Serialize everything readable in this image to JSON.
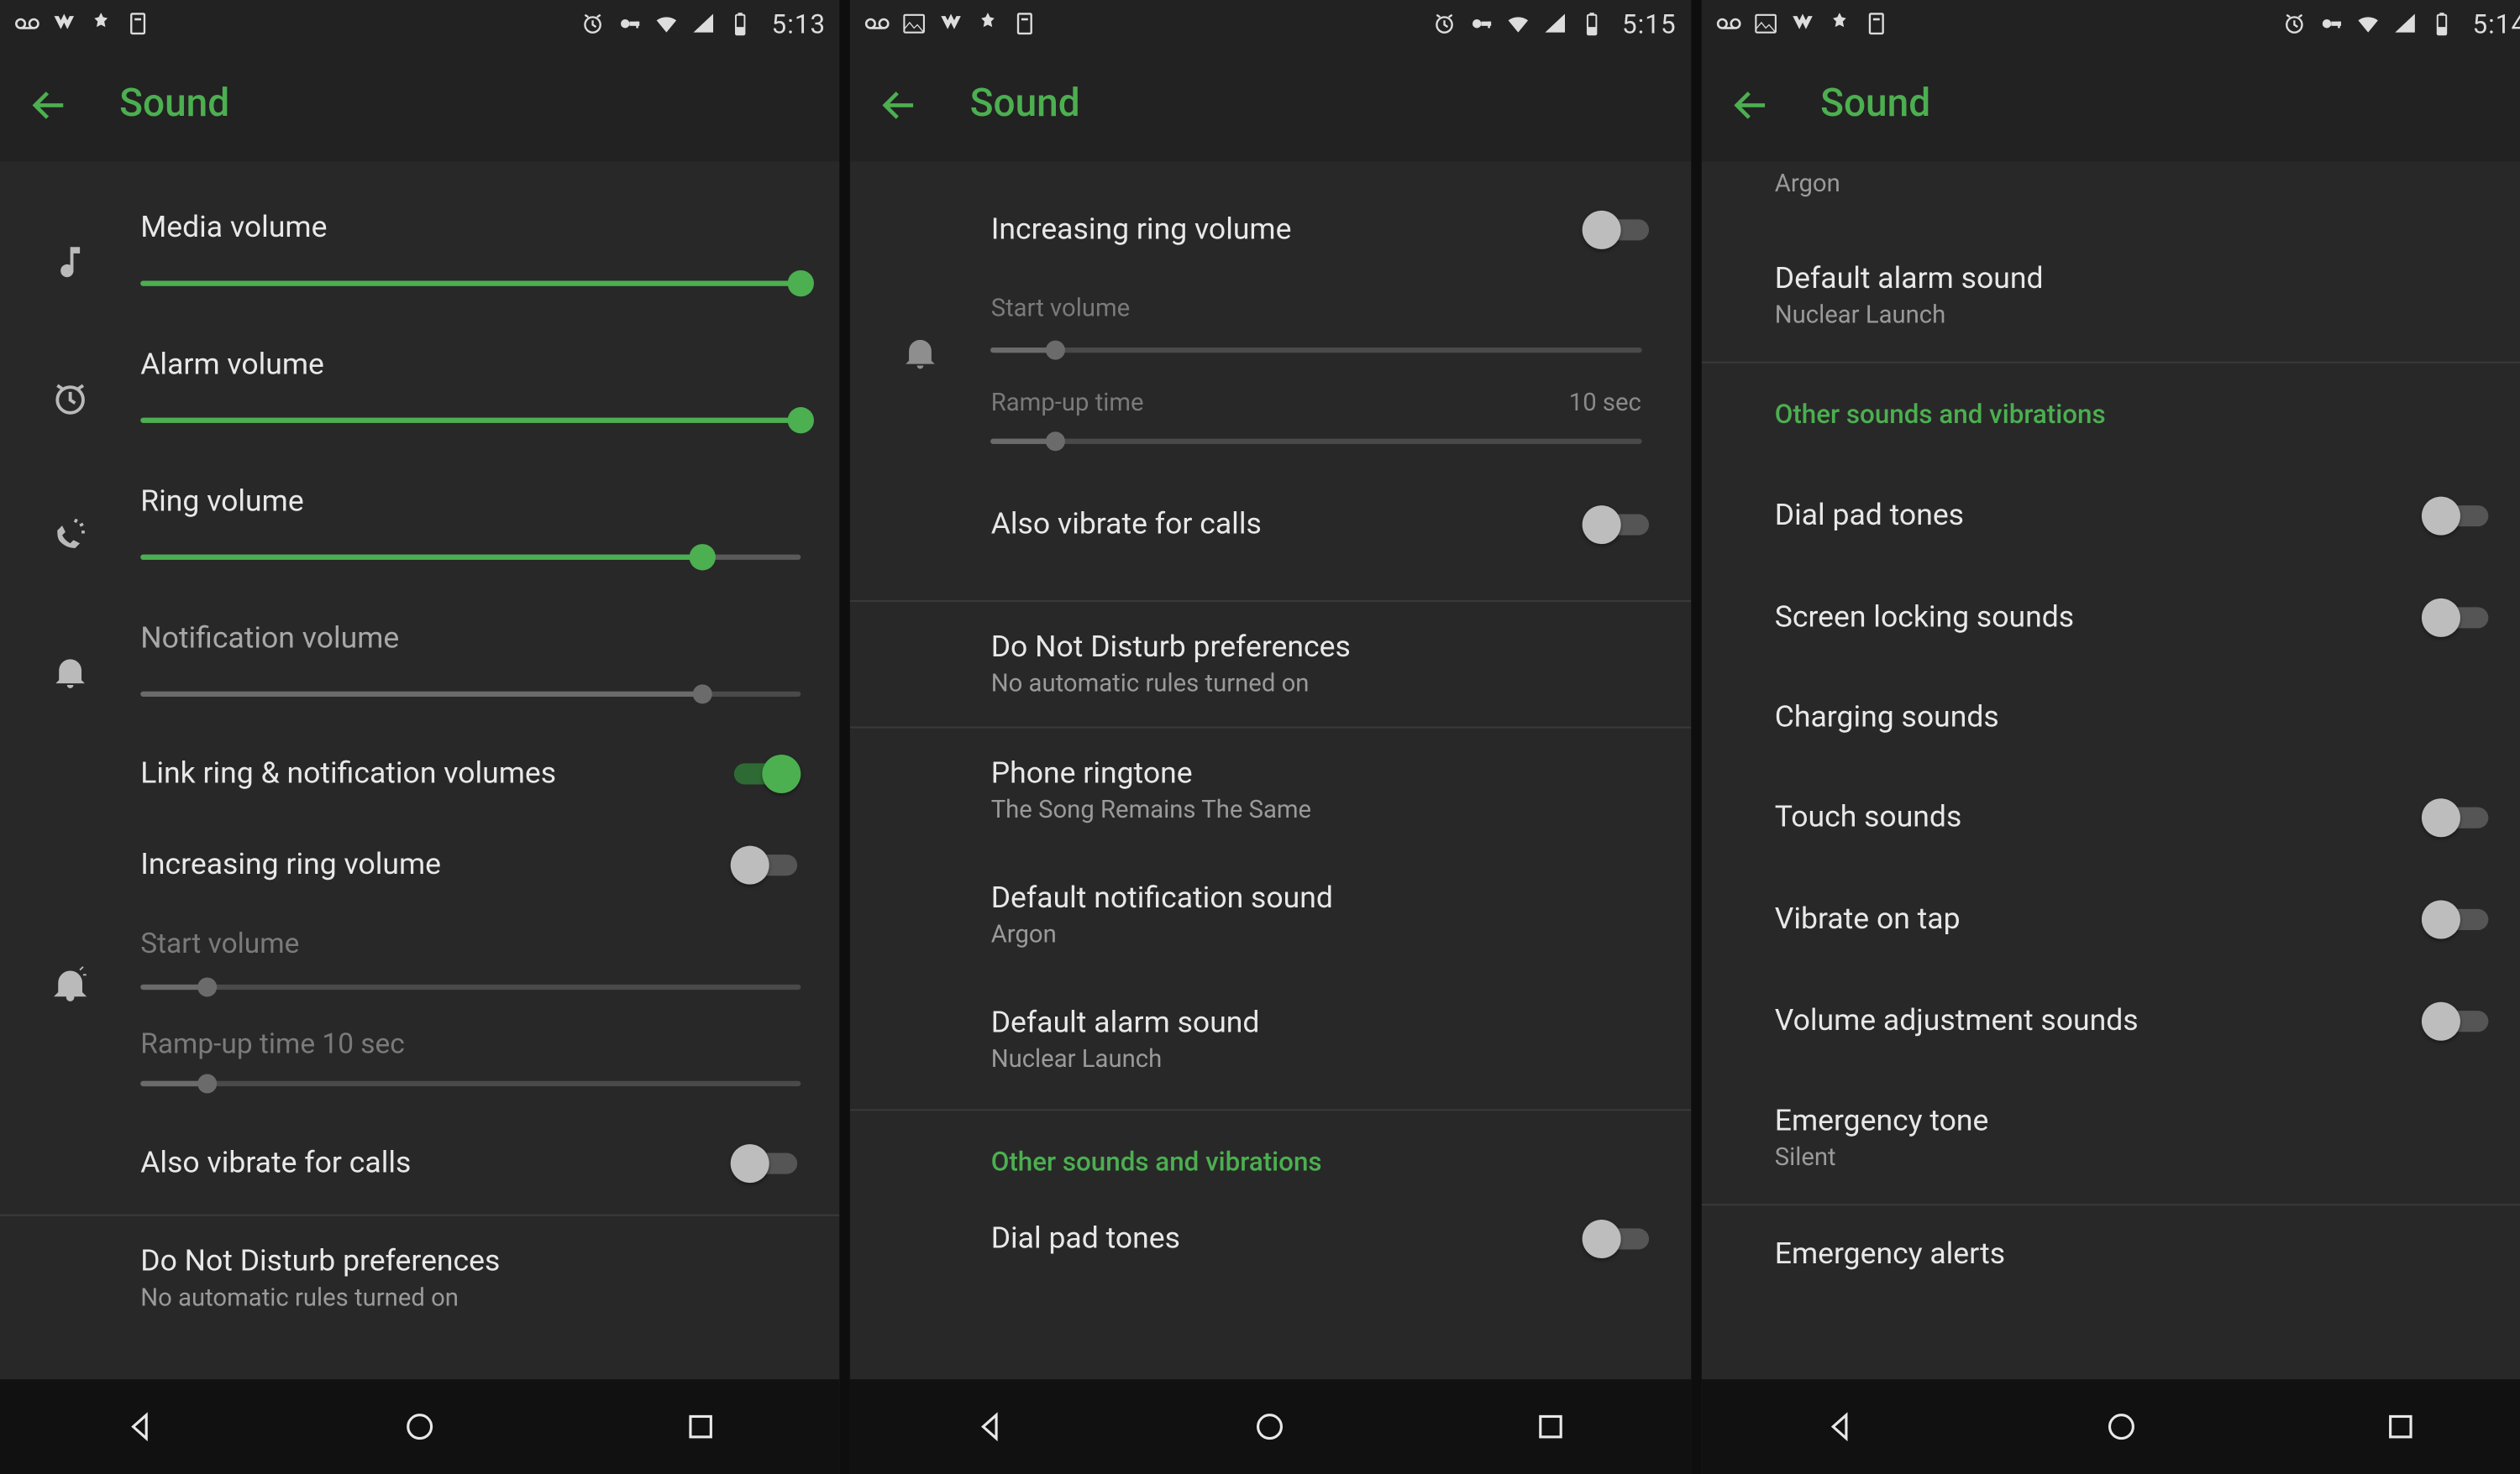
{
  "screens": [
    {
      "status": {
        "time": "5:13"
      },
      "header": {
        "title": "Sound"
      },
      "media": {
        "label": "Media volume",
        "value_pct": 100
      },
      "alarm": {
        "label": "Alarm volume",
        "value_pct": 100
      },
      "ring": {
        "label": "Ring volume",
        "value_pct": 85
      },
      "notif": {
        "label": "Notification volume",
        "value_pct": 85
      },
      "link": {
        "label": "Link ring & notification volumes",
        "on": true
      },
      "increasing": {
        "label": "Increasing ring volume",
        "on": false
      },
      "start": {
        "label": "Start volume",
        "value_pct": 10
      },
      "ramp": {
        "label": "Ramp-up time",
        "value_pct": 10,
        "value_text": "10 sec"
      },
      "vibrate": {
        "label": "Also vibrate for calls",
        "on": false
      },
      "dnd": {
        "label": "Do Not Disturb preferences",
        "sub": "No automatic rules turned on"
      }
    },
    {
      "status": {
        "time": "5:15"
      },
      "header": {
        "title": "Sound"
      },
      "increasing": {
        "label": "Increasing ring volume",
        "on": false
      },
      "start": {
        "label": "Start volume",
        "value_pct": 10
      },
      "ramp": {
        "label": "Ramp-up time",
        "value_pct": 10,
        "value_text": "10 sec"
      },
      "vibrate": {
        "label": "Also vibrate for calls",
        "on": false
      },
      "dnd": {
        "label": "Do Not Disturb preferences",
        "sub": "No automatic rules turned on"
      },
      "ringtone": {
        "label": "Phone ringtone",
        "sub": "The Song Remains The Same"
      },
      "notif_sound": {
        "label": "Default notification sound",
        "sub": "Argon"
      },
      "alarm_sound": {
        "label": "Default alarm sound",
        "sub": "Nuclear Launch"
      },
      "other_header": "Other sounds and vibrations",
      "dialpad": {
        "label": "Dial pad tones",
        "on": false
      }
    },
    {
      "status": {
        "time": "5:14"
      },
      "header": {
        "title": "Sound"
      },
      "argon_tail": "Argon",
      "alarm_sound": {
        "label": "Default alarm sound",
        "sub": "Nuclear Launch"
      },
      "other_header": "Other sounds and vibrations",
      "dialpad": {
        "label": "Dial pad tones",
        "on": false
      },
      "lock": {
        "label": "Screen locking sounds",
        "on": false
      },
      "charge": {
        "label": "Charging sounds"
      },
      "touch": {
        "label": "Touch sounds",
        "on": false
      },
      "tap": {
        "label": "Vibrate on tap",
        "on": false
      },
      "voladj": {
        "label": "Volume adjustment sounds",
        "on": false
      },
      "emergency_tone": {
        "label": "Emergency tone",
        "sub": "Silent"
      },
      "emergency_alerts": {
        "label": "Emergency alerts"
      }
    }
  ]
}
